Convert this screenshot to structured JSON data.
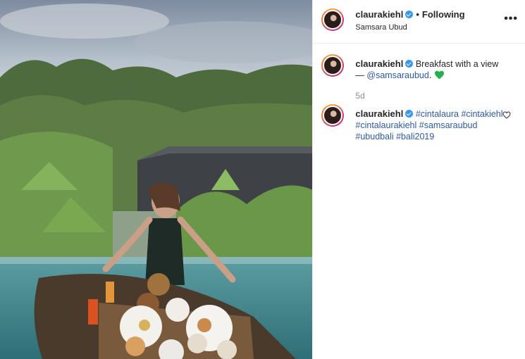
{
  "post": {
    "username": "claurakiehl",
    "follow_dot": "•",
    "follow_status": "Following",
    "location": "Samsara Ubud",
    "more_label": "•••",
    "caption": {
      "username": "claurakiehl",
      "text": "Breakfast with a view —",
      "mention": "@samsaraubud",
      "trailing": "."
    },
    "time_ago": "5d",
    "comment": {
      "username": "claurakiehl",
      "hashtags": [
        "#cintalaura",
        "#cintakiehl",
        "#cintalaurakiehl",
        "#samsaraubud",
        "#ubudbali",
        "#bali2019"
      ]
    }
  },
  "colors": {
    "verified": "#3897f0",
    "link": "#2b5aa8",
    "heart": "#22b14c"
  },
  "icons": [
    "verified-badge-icon",
    "more-options-icon",
    "green-heart-icon",
    "like-heart-icon"
  ]
}
